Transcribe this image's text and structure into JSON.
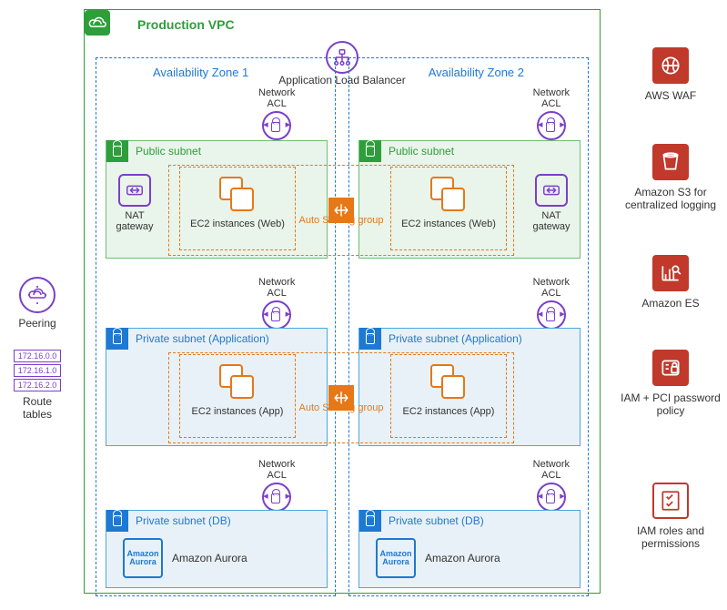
{
  "vpc": {
    "title": "Production VPC"
  },
  "alb": {
    "label": "Application Load Balancer"
  },
  "az": {
    "z1": "Availability Zone 1",
    "z2": "Availability Zone 2"
  },
  "nacl": {
    "label": "Network\nACL"
  },
  "subnets": {
    "public": "Public subnet",
    "privApp": "Private subnet (Application)",
    "privDb": "Private subnet (DB)"
  },
  "nat": {
    "label": "NAT\ngateway"
  },
  "ec2": {
    "web": "EC2 instances (Web)",
    "app": "EC2 instances (App)"
  },
  "asg": {
    "label": "Auto Scaling group"
  },
  "aurora": {
    "brand": "Amazon Aurora",
    "label": "Amazon Aurora"
  },
  "left": {
    "peering": "Peering",
    "rt": {
      "label": "Route\ntables",
      "ips": [
        "172.16.0.0",
        "172.16.1.0",
        "172.16.2.0"
      ]
    }
  },
  "right": {
    "waf": "AWS WAF",
    "s3": "Amazon S3 for centralized logging",
    "es": "Amazon ES",
    "iamPwd": "IAM + PCI password policy",
    "iamRoles": "IAM roles and permissions"
  }
}
